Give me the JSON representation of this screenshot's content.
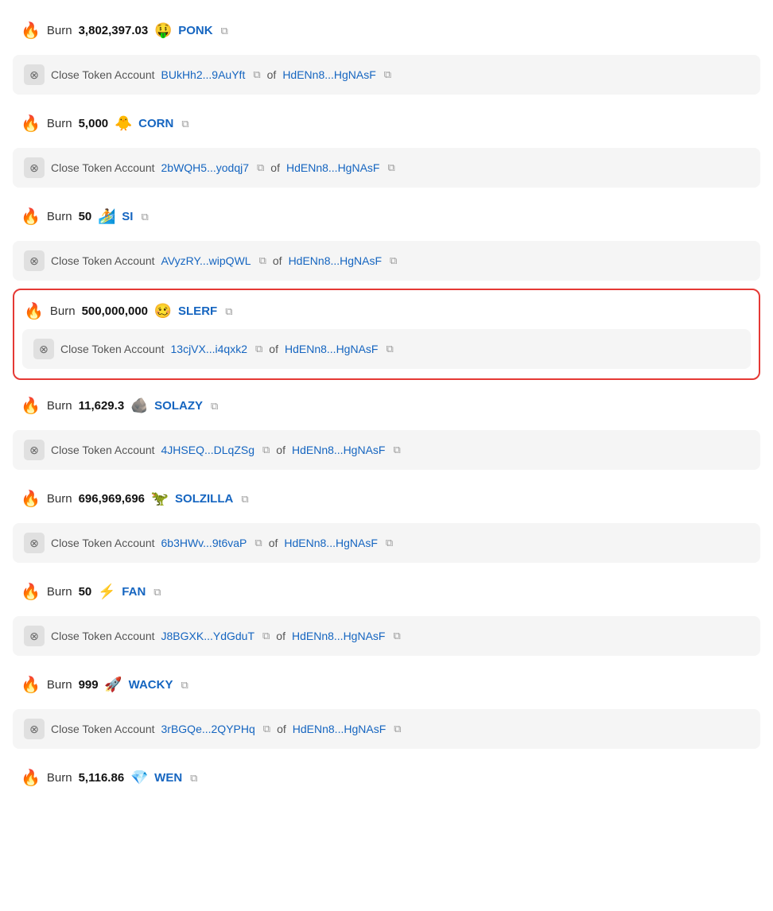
{
  "items": [
    {
      "id": 1,
      "type": "burn",
      "amount": "3,802,397.03",
      "tokenIcon": "🤑",
      "tokenName": "PONK",
      "highlighted": false,
      "closeAccount": {
        "address": "BUkHh2...9AuYft",
        "owner": "HdENn8...HgNAsF"
      }
    },
    {
      "id": 2,
      "type": "burn",
      "amount": "5,000",
      "tokenIcon": "🐥",
      "tokenName": "CORN",
      "highlighted": false,
      "closeAccount": {
        "address": "2bWQH5...yodqj7",
        "owner": "HdENn8...HgNAsF"
      }
    },
    {
      "id": 3,
      "type": "burn",
      "amount": "50",
      "tokenIcon": "🏄",
      "tokenName": "SI",
      "highlighted": false,
      "closeAccount": {
        "address": "AVyzRY...wipQWL",
        "owner": "HdENn8...HgNAsF"
      }
    },
    {
      "id": 4,
      "type": "burn",
      "amount": "500,000,000",
      "tokenIcon": "🥴",
      "tokenName": "SLERF",
      "highlighted": true,
      "closeAccount": {
        "address": "13cjVX...i4qxk2",
        "owner": "HdENn8...HgNAsF"
      }
    },
    {
      "id": 5,
      "type": "burn",
      "amount": "11,629.3",
      "tokenIcon": "🪨",
      "tokenName": "SOLAZY",
      "highlighted": false,
      "closeAccount": {
        "address": "4JHSEQ...DLqZSg",
        "owner": "HdENn8...HgNAsF"
      }
    },
    {
      "id": 6,
      "type": "burn",
      "amount": "696,969,696",
      "tokenIcon": "🦖",
      "tokenName": "SOLZILLA",
      "highlighted": false,
      "closeAccount": {
        "address": "6b3HWv...9t6vaP",
        "owner": "HdENn8...HgNAsF"
      }
    },
    {
      "id": 7,
      "type": "burn",
      "amount": "50",
      "tokenIcon": "⚡",
      "tokenName": "FAN",
      "highlighted": false,
      "closeAccount": {
        "address": "J8BGXK...YdGduT",
        "owner": "HdENn8...HgNAsF"
      }
    },
    {
      "id": 8,
      "type": "burn",
      "amount": "999",
      "tokenIcon": "🚀",
      "tokenName": "WACKY",
      "highlighted": false,
      "closeAccount": {
        "address": "3rBGQe...2QYPHq",
        "owner": "HdENn8...HgNAsF"
      }
    },
    {
      "id": 9,
      "type": "burn",
      "amount": "5,116.86",
      "tokenIcon": "💎",
      "tokenName": "WEN",
      "highlighted": false,
      "closeAccount": null
    }
  ],
  "labels": {
    "burn": "Burn",
    "closeTokenAccount": "Close Token Account",
    "of": "of"
  }
}
